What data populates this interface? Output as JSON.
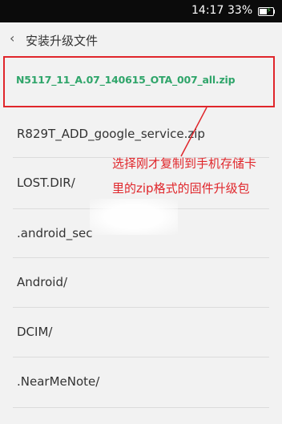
{
  "statusbar": {
    "time": "14:17",
    "battery": "33%"
  },
  "header": {
    "title": "安装升级文件"
  },
  "files": [
    {
      "name": "N5117_11_A.07_140615_OTA_007_all.zip"
    },
    {
      "name": "R829T_ADD_google_service.zip"
    },
    {
      "name": "LOST.DIR/"
    },
    {
      "name": ".android_sec"
    },
    {
      "name": "Android/"
    },
    {
      "name": "DCIM/"
    },
    {
      "name": ".NearMeNote/"
    }
  ],
  "annotation": {
    "line1": "选择刚才复制到手机存储卡",
    "line2": "里的zip格式的固件升级包"
  },
  "colors": {
    "highlight": "#e0262b",
    "selected_text": "#2fa56a",
    "battery_charge": "#49b84b"
  }
}
